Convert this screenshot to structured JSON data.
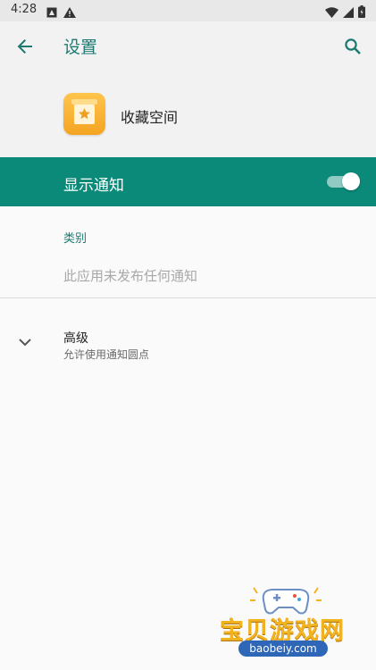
{
  "status_bar": {
    "time": "4:28"
  },
  "appbar": {
    "title": "设置"
  },
  "app": {
    "name": "收藏空间"
  },
  "notification_toggle": {
    "label": "显示通知",
    "enabled": true
  },
  "category_section": {
    "title": "类别",
    "empty_message": "此应用未发布任何通知"
  },
  "advanced": {
    "title": "高级",
    "subtitle": "允许使用通知圆点"
  },
  "watermark": {
    "text": "宝贝游戏网",
    "url": "baobeiy.com"
  },
  "colors": {
    "accent": "#0b8a7a",
    "title": "#1d7a71",
    "icon": "#f4a422"
  }
}
